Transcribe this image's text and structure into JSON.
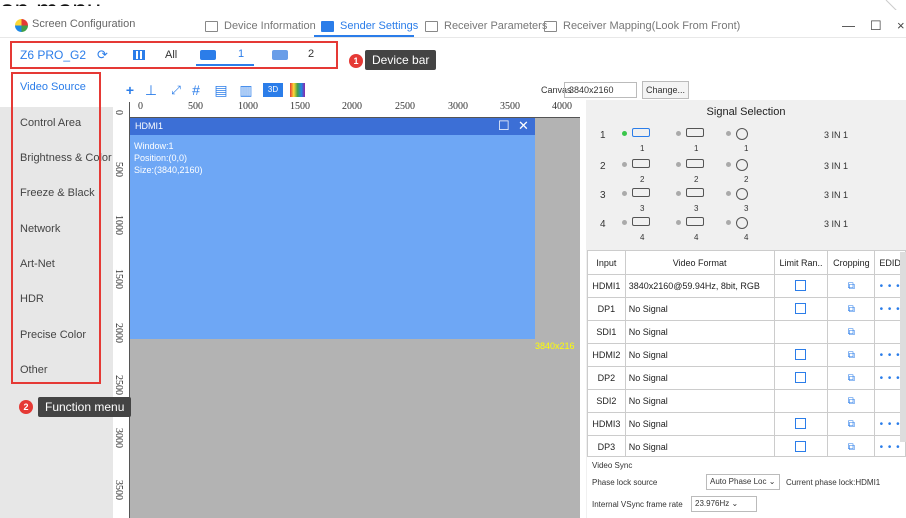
{
  "window": {
    "title": "Screen Configuration"
  },
  "tabs": [
    {
      "label": "Device Information",
      "icon": "info-icon"
    },
    {
      "label": "Sender Settings",
      "icon": "sender-icon"
    },
    {
      "label": "Receiver Parameters",
      "icon": "receiver-params-icon"
    },
    {
      "label": "Receiver Mapping(Look From Front)",
      "icon": "mapping-icon"
    }
  ],
  "device_bar": {
    "device_name": "Z6 PRO_G2",
    "all_label": "All",
    "device1": "1",
    "device2": "2"
  },
  "annotations": {
    "badge1": "1",
    "callout1": "Device bar",
    "badge2": "2",
    "callout2": "Function menu"
  },
  "sidebar": {
    "items": [
      "Video Source",
      "Control Area",
      "Brightness & Color",
      "Freeze & Black",
      "Network",
      "Art-Net",
      "HDR",
      "Precise Color",
      "Other"
    ]
  },
  "toolbar": {
    "mode_3d": "3D",
    "canvas_label": "Canvas",
    "canvas_value": "3840x2160",
    "change_button": "Change..."
  },
  "ruler": {
    "h_ticks": [
      "0",
      "500",
      "1000",
      "1500",
      "2000",
      "2500",
      "3000",
      "3500",
      "4000"
    ],
    "v_ticks": [
      "0",
      "500",
      "1000",
      "1500",
      "2000",
      "2500",
      "3000",
      "3500"
    ]
  },
  "hdmi_window": {
    "title": "HDMI1",
    "line1": "Window:1",
    "line2": "Position:(0,0)",
    "line3": "Size:(3840,2160)",
    "canvas_size_label": "3840x216"
  },
  "signal_selection": {
    "title": "Signal Selection",
    "rows": [
      {
        "num": "1",
        "ports": [
          "1",
          "1",
          "1"
        ],
        "mode": "3 IN 1"
      },
      {
        "num": "2",
        "ports": [
          "2",
          "2",
          "2"
        ],
        "mode": "3 IN 1"
      },
      {
        "num": "3",
        "ports": [
          "3",
          "3",
          "3"
        ],
        "mode": "3 IN 1"
      },
      {
        "num": "4",
        "ports": [
          "4",
          "4",
          "4"
        ],
        "mode": "3 IN 1"
      }
    ]
  },
  "input_table": {
    "headers": [
      "Input",
      "Video Format",
      "Limit Ran..",
      "Cropping",
      "EDID"
    ],
    "rows": [
      {
        "input": "HDMI1",
        "format": "3840x2160@59.94Hz, 8bit, RGB",
        "limit": true,
        "edid": true
      },
      {
        "input": "DP1",
        "format": "No Signal",
        "limit": true,
        "edid": true
      },
      {
        "input": "SDI1",
        "format": "No Signal",
        "limit": false,
        "edid": false
      },
      {
        "input": "HDMI2",
        "format": "No Signal",
        "limit": true,
        "edid": true
      },
      {
        "input": "DP2",
        "format": "No Signal",
        "limit": true,
        "edid": true
      },
      {
        "input": "SDI2",
        "format": "No Signal",
        "limit": false,
        "edid": false
      },
      {
        "input": "HDMI3",
        "format": "No Signal",
        "limit": true,
        "edid": true
      },
      {
        "input": "DP3",
        "format": "No Signal",
        "limit": true,
        "edid": true
      }
    ],
    "edid_dots": "• • •"
  },
  "video_sync": {
    "title": "Video Sync",
    "phase_lock_label": "Phase lock source",
    "phase_lock_value": "Auto Phase Loc",
    "current_phase": "Current phase lock:HDMI1",
    "vsync_label": "Internal VSync frame rate",
    "vsync_value": "23.976Hz"
  },
  "truncated_heading": "on menu."
}
